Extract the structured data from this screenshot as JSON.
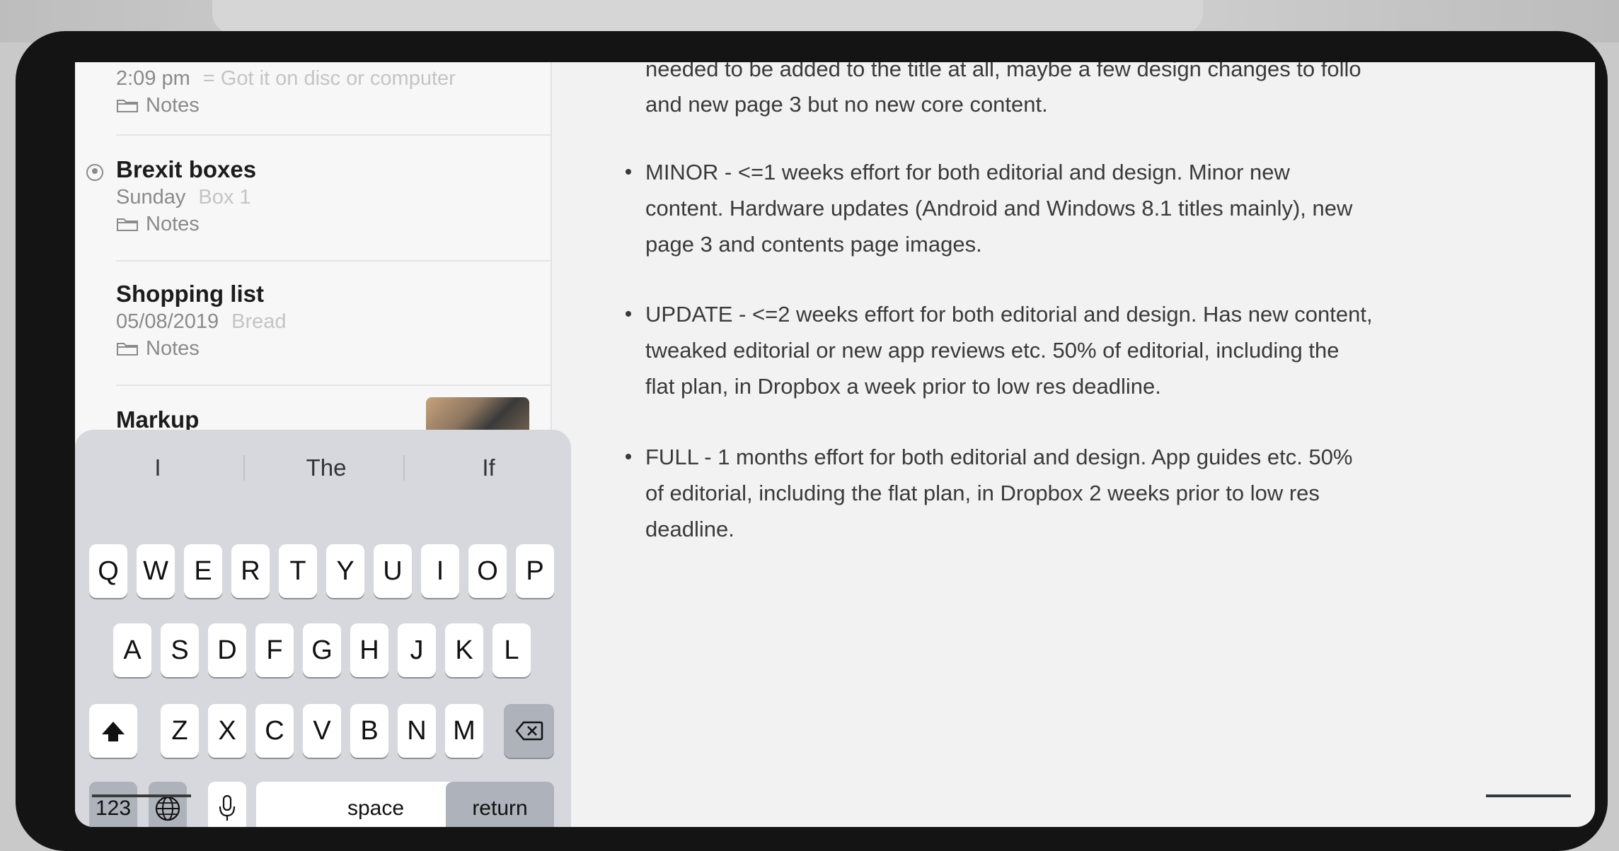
{
  "sidebar": {
    "notes": [
      {
        "title": "",
        "date": "2:09 pm",
        "preview": "= Got it on disc or computer",
        "folder": "Notes"
      },
      {
        "title": "Brexit boxes",
        "date": "Sunday",
        "preview": "Box 1",
        "folder": "Notes",
        "shared": true
      },
      {
        "title": "Shopping list",
        "date": "05/08/2019",
        "preview": "Bread",
        "folder": "Notes"
      },
      {
        "title": "Markup",
        "date": "",
        "preview": "",
        "folder": "",
        "has_thumbnail": true
      }
    ]
  },
  "note_body": {
    "intro_line1": "needed to be added to the title at all, maybe a few design changes to follo",
    "intro_line2": "and new page 3 but no new core content.",
    "bullets": [
      {
        "lines": [
          "MINOR - <=1 weeks effort for both editorial and design. Minor new",
          "content. Hardware updates (Android and Windows 8.1 titles mainly), new",
          "page 3 and contents page images."
        ]
      },
      {
        "lines": [
          "UPDATE - <=2 weeks effort for both editorial and design. Has new content,",
          "tweaked editorial or new app reviews etc. 50% of editorial, including the",
          "flat plan, in Dropbox a week prior to low res deadline."
        ]
      },
      {
        "lines": [
          "FULL - 1 months effort for both editorial and design. App guides etc. 50%",
          "of editorial, including the flat plan, in Dropbox 2 weeks prior to low res",
          "deadline."
        ]
      }
    ]
  },
  "keyboard": {
    "predictions": [
      "I",
      "The",
      "If"
    ],
    "row1": [
      "Q",
      "W",
      "E",
      "R",
      "T",
      "Y",
      "U",
      "I",
      "O",
      "P"
    ],
    "row2": [
      "A",
      "S",
      "D",
      "F",
      "G",
      "H",
      "J",
      "K",
      "L"
    ],
    "row3": [
      "Z",
      "X",
      "C",
      "V",
      "B",
      "N",
      "M"
    ],
    "numbers_label": "123",
    "space_label": "space",
    "return_label": "return",
    "icons": {
      "shift": "shift-icon",
      "backspace": "backspace-icon",
      "globe": "globe-icon",
      "mic": "microphone-icon"
    }
  }
}
